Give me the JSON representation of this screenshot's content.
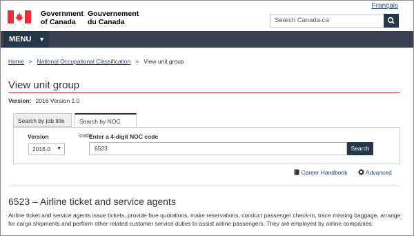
{
  "header": {
    "language_toggle": "Français",
    "signature_en_line1": "Government",
    "signature_en_line2": "of Canada",
    "signature_fr_line1": "Gouvernement",
    "signature_fr_line2": "du Canada",
    "search_placeholder": "Search Canada.ca",
    "flag_color": "#eb2d37"
  },
  "menu": {
    "label": "MENU"
  },
  "breadcrumb": {
    "items": [
      "Home",
      "National Occupational Classification",
      "View unit group"
    ],
    "separator": ">"
  },
  "page": {
    "title": "View unit group",
    "version_label": "Version:",
    "version_value": "2016 Version 1.0"
  },
  "tabs": [
    "Search by job title",
    "Search by NOC code"
  ],
  "form": {
    "version_label": "Version",
    "version_selected": "2016.0",
    "code_label": "Enter a 4-digit NOC code",
    "code_value": "6523",
    "search_button": "Search"
  },
  "tools": {
    "career_handbook": "Career Handbook",
    "advanced": "Advanced"
  },
  "result": {
    "heading": "6523 – Airline ticket and service agents",
    "description": "Airline ticket and service agents issue tickets, provide fare quotations, make reservations, conduct passenger check-in, trace missing baggage, arrange for cargo shipments and perform other related customer service duties to assist airline passengers. They are employed by airline companies."
  }
}
